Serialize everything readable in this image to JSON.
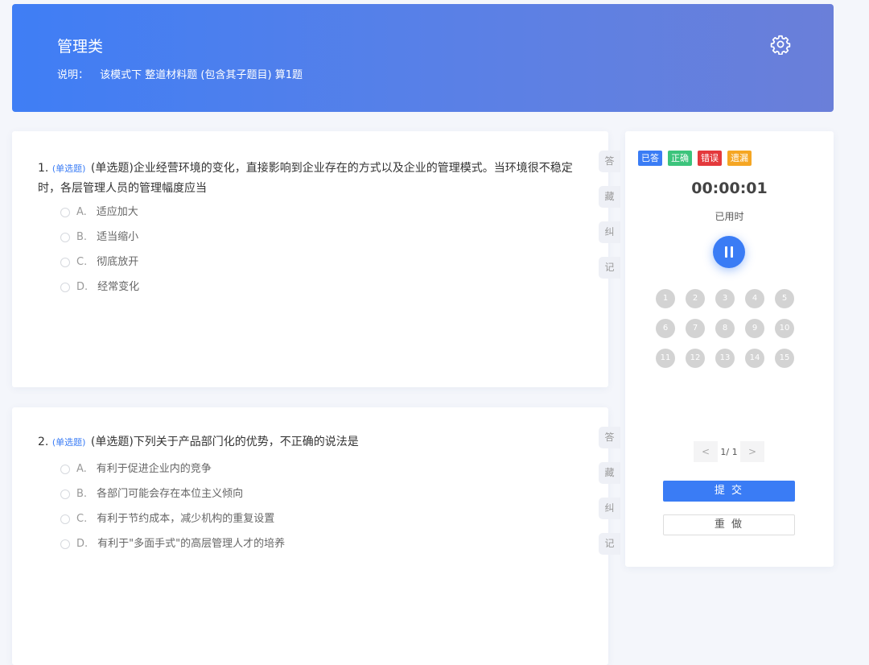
{
  "header": {
    "title": "管理类",
    "desc_label": "说明：",
    "desc_text": "该模式下 整道材料题 (包含其子题目) 算1题"
  },
  "questions": [
    {
      "number": "1.",
      "tag": "(单选题)",
      "text": "(单选题)企业经营环境的变化，直接影响到企业存在的方式以及企业的管理模式。当环境很不稳定时，各层管理人员的管理幅度应当",
      "options": [
        {
          "letter": "A.",
          "text": "适应加大"
        },
        {
          "letter": "B.",
          "text": "适当缩小"
        },
        {
          "letter": "C.",
          "text": "彻底放开"
        },
        {
          "letter": "D.",
          "text": "经常变化"
        }
      ]
    },
    {
      "number": "2.",
      "tag": "(单选题)",
      "text": "(单选题)下列关于产品部门化的优势，不正确的说法是",
      "options": [
        {
          "letter": "A.",
          "text": "有利于促进企业内的竞争"
        },
        {
          "letter": "B.",
          "text": "各部门可能会存在本位主义倾向"
        },
        {
          "letter": "C.",
          "text": "有利于节约成本，减少机构的重复设置"
        },
        {
          "letter": "D.",
          "text": "有利于\"多面手式\"的高层管理人才的培养"
        }
      ]
    }
  ],
  "side_buttons": [
    "答",
    "藏",
    "纠",
    "记"
  ],
  "panel": {
    "legend": [
      {
        "label": "已答",
        "color": "#3a7cf5"
      },
      {
        "label": "正确",
        "color": "#3cc47c"
      },
      {
        "label": "错误",
        "color": "#e4393c"
      },
      {
        "label": "遗漏",
        "color": "#f5a623"
      }
    ],
    "timer": "00:00:01",
    "timer_label": "已用时",
    "numbers": [
      "1",
      "2",
      "3",
      "4",
      "5",
      "6",
      "7",
      "8",
      "9",
      "10",
      "11",
      "12",
      "13",
      "14",
      "15"
    ],
    "pager": {
      "prev": "<",
      "info": "1/ 1",
      "next": ">"
    },
    "submit": "提 交",
    "redo": "重 做"
  }
}
